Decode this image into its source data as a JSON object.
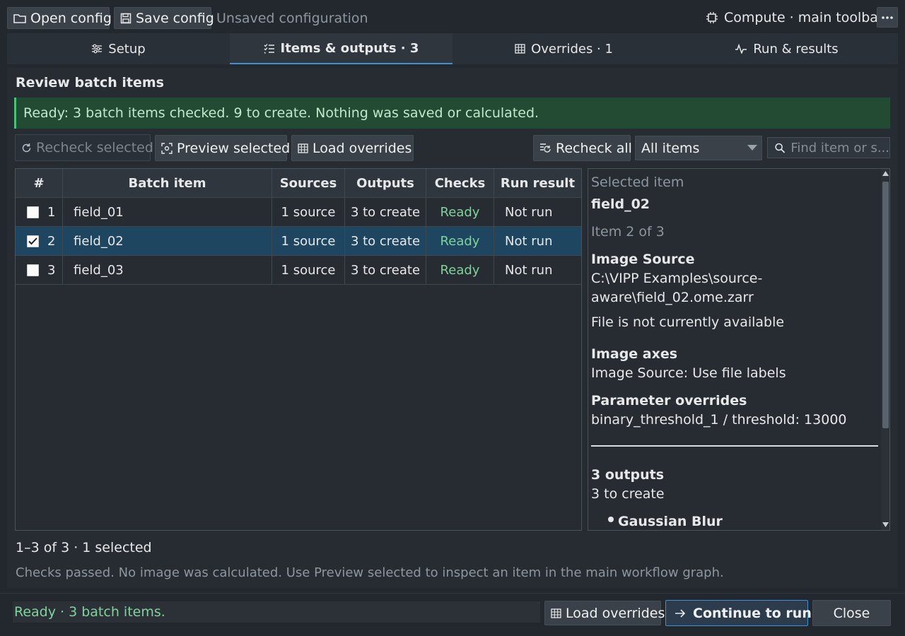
{
  "toolbar": {
    "open_config": "Open config",
    "save_config": "Save config",
    "unsaved_label": "Unsaved configuration",
    "context_label": "Compute · main toolbar"
  },
  "tabs": [
    {
      "label": "Setup",
      "icon": "sliders-icon"
    },
    {
      "label": "Items & outputs · 3",
      "icon": "checklist-icon"
    },
    {
      "label": "Overrides · 1",
      "icon": "table-icon"
    },
    {
      "label": "Run & results",
      "icon": "activity-icon"
    }
  ],
  "section_title": "Review batch items",
  "banner": "Ready: 3 batch items checked. 9 to create. Nothing was saved or calculated.",
  "actions": {
    "recheck_selected": "Recheck selected",
    "preview_selected": "Preview selected",
    "load_overrides": "Load overrides",
    "recheck_all": "Recheck all",
    "filter_value": "All items",
    "search_placeholder": "Find item or s..."
  },
  "table": {
    "columns": [
      "#",
      "Batch item",
      "Sources",
      "Outputs",
      "Checks",
      "Run result"
    ],
    "rows": [
      {
        "num": "1",
        "item": "field_01",
        "sources": "1 source",
        "outputs": "3 to create",
        "checks": "Ready",
        "result": "Not run",
        "checked": false
      },
      {
        "num": "2",
        "item": "field_02",
        "sources": "1 source",
        "outputs": "3 to create",
        "checks": "Ready",
        "result": "Not run",
        "checked": true
      },
      {
        "num": "3",
        "item": "field_03",
        "sources": "1 source",
        "outputs": "3 to create",
        "checks": "Ready",
        "result": "Not run",
        "checked": false
      }
    ]
  },
  "detail": {
    "heading": "Selected item",
    "name": "field_02",
    "position": "Item 2 of 3",
    "source_title": "Image Source",
    "source_path_1": "C:\\VIPP Examples\\source-",
    "source_path_2": "aware\\field_02.ome.zarr",
    "source_status": "File is not currently available",
    "axes_title": "Image axes",
    "axes_value": "Image Source: Use file labels",
    "overrides_title": "Parameter overrides",
    "overrides_value": "binary_threshold_1 / threshold: 13000",
    "outputs_title": "3 outputs",
    "outputs_value": "3 to create",
    "output_items": [
      "Gaussian Blur"
    ]
  },
  "summary": "1–3 of 3 · 1 selected",
  "hint": "Checks passed. No image was calculated. Use Preview selected to inspect an item in the main workflow graph.",
  "footer": {
    "status": "Ready · 3 batch items.",
    "load_overrides": "Load overrides",
    "continue": "Continue to run",
    "close": "Close"
  },
  "colors": {
    "accent": "#3d8fd6",
    "ready": "#7fd49a",
    "banner_bg": "#234a33",
    "selected_row": "#1e4660"
  }
}
